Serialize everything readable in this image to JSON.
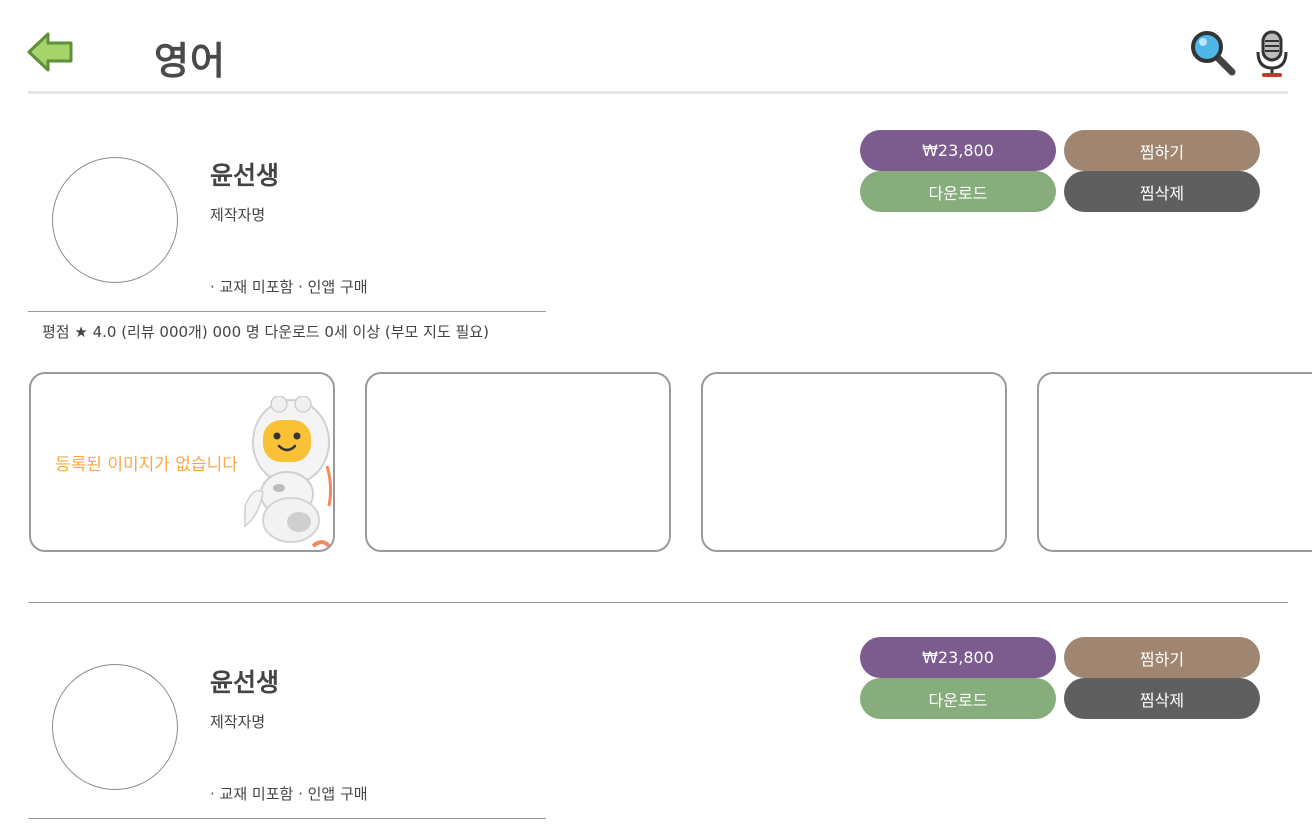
{
  "header": {
    "title": "영어",
    "back_icon": "back-arrow-icon",
    "search_icon": "search-icon",
    "mic_icon": "microphone-icon"
  },
  "products": [
    {
      "name": "윤선생",
      "maker": "제작자명",
      "tags": "· 교재 미포함 · 인앱 구매",
      "rating_text": "평점 ★ 4.0 (리뷰 000개)   000 명 다운로드   0세 이상 (부모 지도 필요)",
      "price_label": "₩23,800",
      "wish_label": "찜하기",
      "download_label": "다운로드",
      "unwish_label": "찜삭제",
      "thumbnails": [
        {
          "text": "등록된 이미지가 없습니다"
        },
        {
          "text": ""
        },
        {
          "text": ""
        },
        {
          "text": ""
        }
      ]
    },
    {
      "name": "윤선생",
      "maker": "제작자명",
      "tags": "· 교재 미포함 · 인앱 구매",
      "price_label": "₩23,800",
      "wish_label": "찜하기",
      "download_label": "다운로드",
      "unwish_label": "찜삭제"
    }
  ],
  "colors": {
    "price": "#7c5b8e",
    "wish": "#a08670",
    "download": "#86ad7b",
    "unwish": "#5f5f5f",
    "no_image_text": "#f7a948"
  }
}
